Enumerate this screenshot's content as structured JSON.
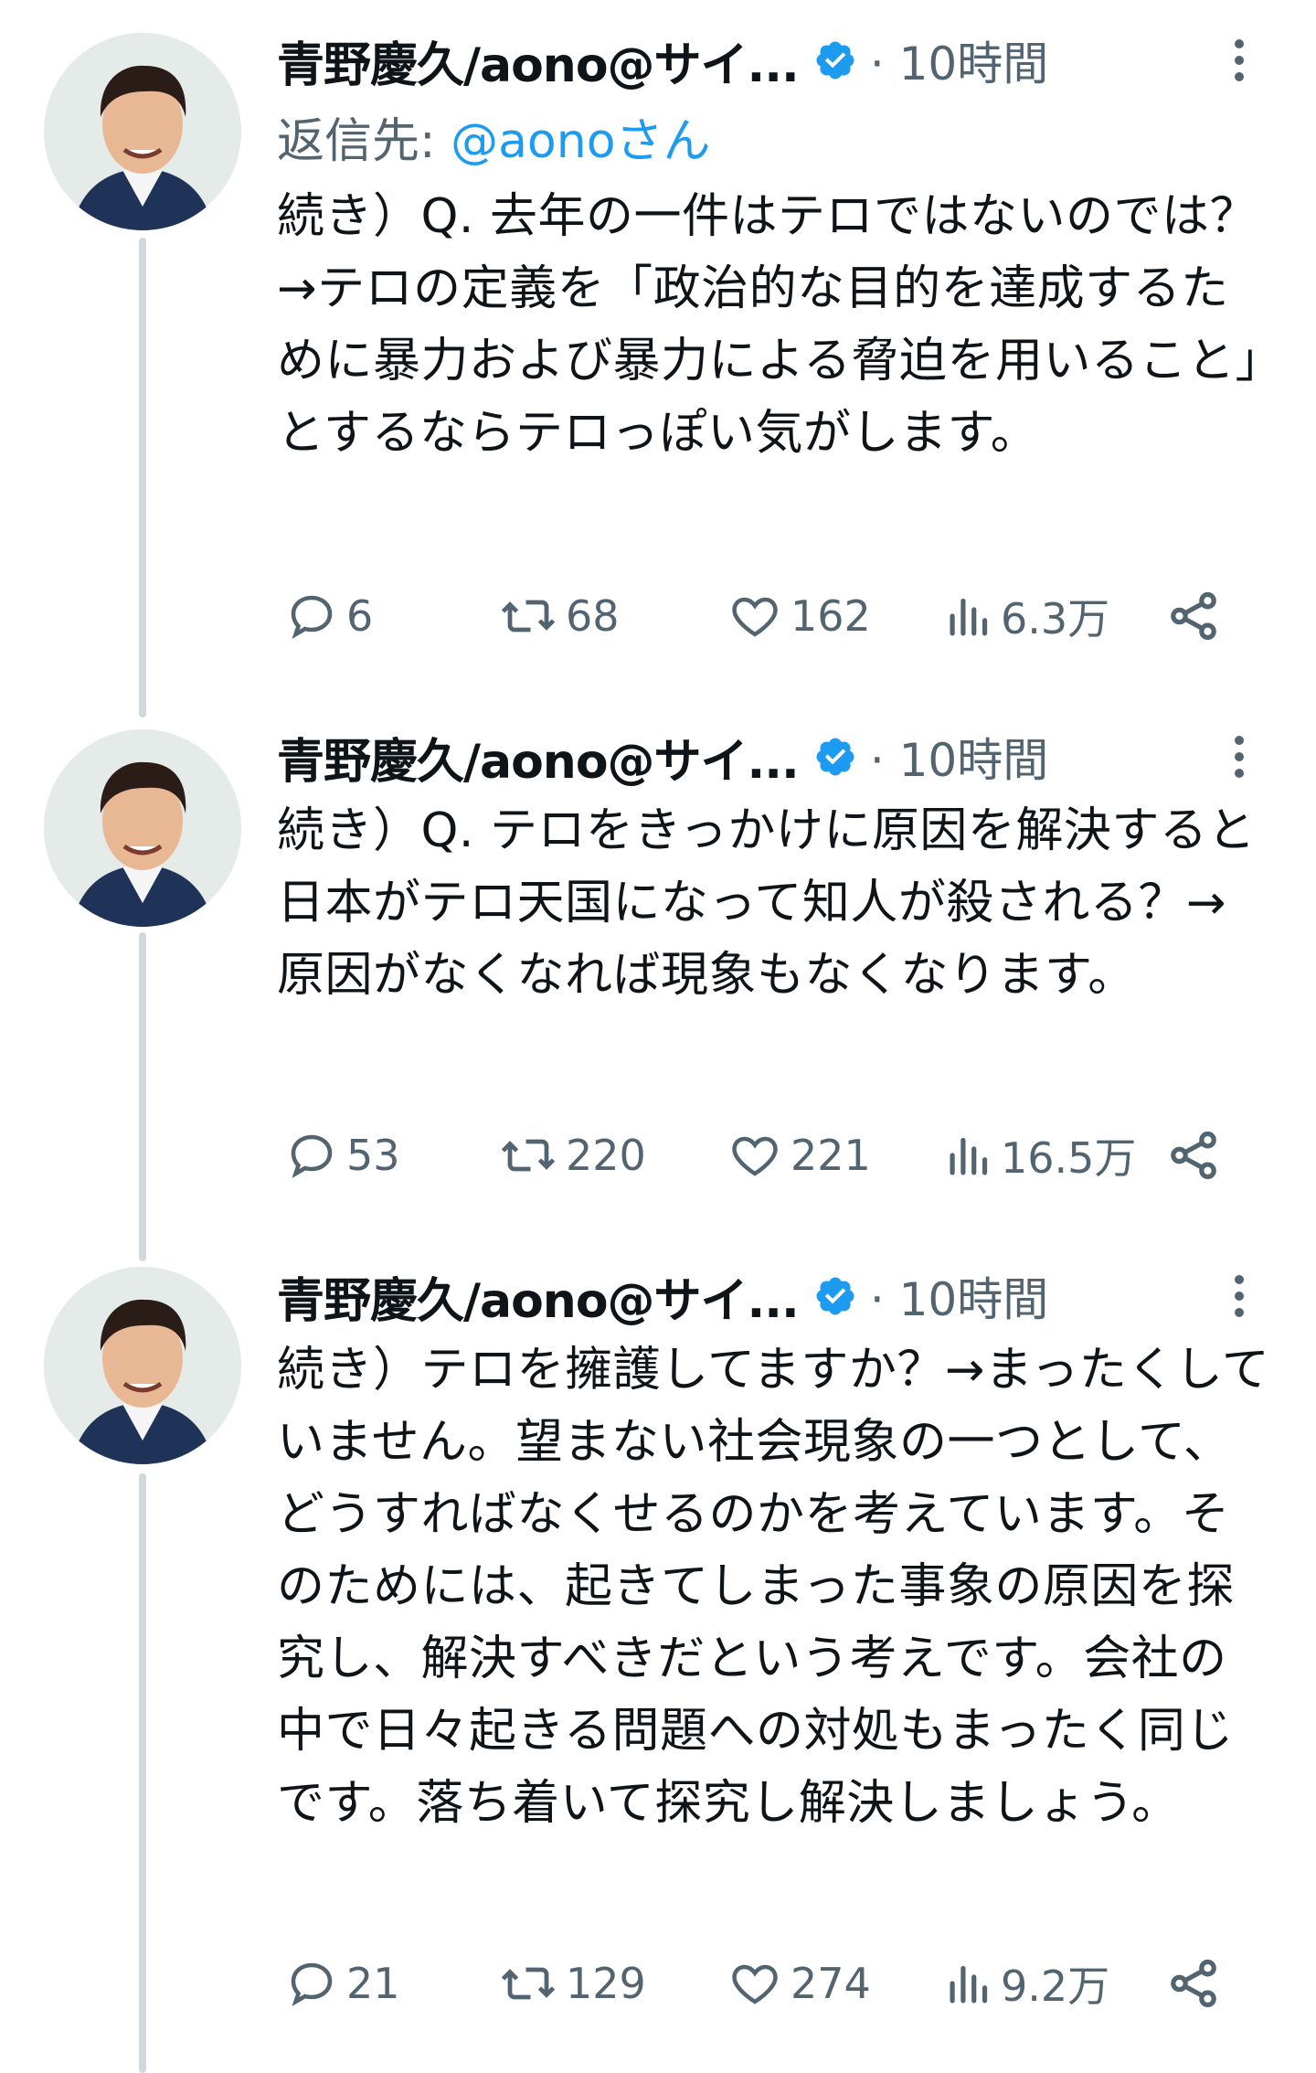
{
  "tweets": [
    {
      "author": "青野慶久/aono@サイ...",
      "time": "· 10時間",
      "reply_label": "返信先: ",
      "reply_mention": "@aonoさん",
      "text": "続き）Q. 去年の一件はテロではないのでは？→テロの定義を「政治的な目的を達成するために暴力および暴力による脅迫を用いること」とするならテロっぽい気がします。",
      "replies": "6",
      "retweets": "68",
      "likes": "162",
      "views": "6.3万"
    },
    {
      "author": "青野慶久/aono@サイ...",
      "time": "· 10時間",
      "text": "続き）Q. テロをきっかけに原因を解決すると日本がテロ天国になって知人が殺される？→原因がなくなれば現象もなくなります。",
      "replies": "53",
      "retweets": "220",
      "likes": "221",
      "views": "16.5万"
    },
    {
      "author": "青野慶久/aono@サイ...",
      "time": "· 10時間",
      "text": "続き）テロを擁護してますか？→まったくしていません。望まない社会現象の一つとして、どうすればなくせるのかを考えています。そのためには、起きてしまった事象の原因を探究し、解決すべきだという考えです。会社の中で日々起きる問題への対処もまったく同じです。落ち着いて探究し解決しましょう。",
      "replies": "21",
      "retweets": "129",
      "likes": "274",
      "views": "9.2万"
    }
  ],
  "icons": {
    "verified": "verified-badge-icon",
    "more": "more-vertical-icon",
    "reply": "reply-bubble-icon",
    "retweet": "retweet-icon",
    "like": "heart-icon",
    "views": "views-bar-chart-icon",
    "share": "share-icon"
  },
  "colors": {
    "text": "#0f1419",
    "secondary": "#536471",
    "accent": "#1d9bf0",
    "thread_line": "#cfd9de"
  }
}
